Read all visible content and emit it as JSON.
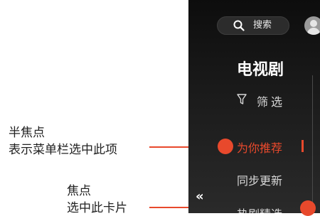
{
  "annotations": {
    "half_focus": {
      "title": "半焦点",
      "desc": "表示菜单栏选中此项"
    },
    "focus": {
      "title": "焦点",
      "desc": "选中此卡片"
    }
  },
  "header": {
    "search_label": "搜索",
    "search_icon": "search-icon",
    "avatar_icon": "user-avatar-icon"
  },
  "sidebar": {
    "title": "电视剧",
    "filter_label": "筛选",
    "filter_icon": "funnel-icon",
    "items": [
      {
        "label": "为你推荐",
        "active": true
      },
      {
        "label": "同步更新"
      },
      {
        "label": "热剧精选"
      }
    ],
    "collapse_label": "«"
  },
  "colors": {
    "accent": "#e8492c",
    "screen_bg": "#141414",
    "text": "#d9d9d9"
  }
}
